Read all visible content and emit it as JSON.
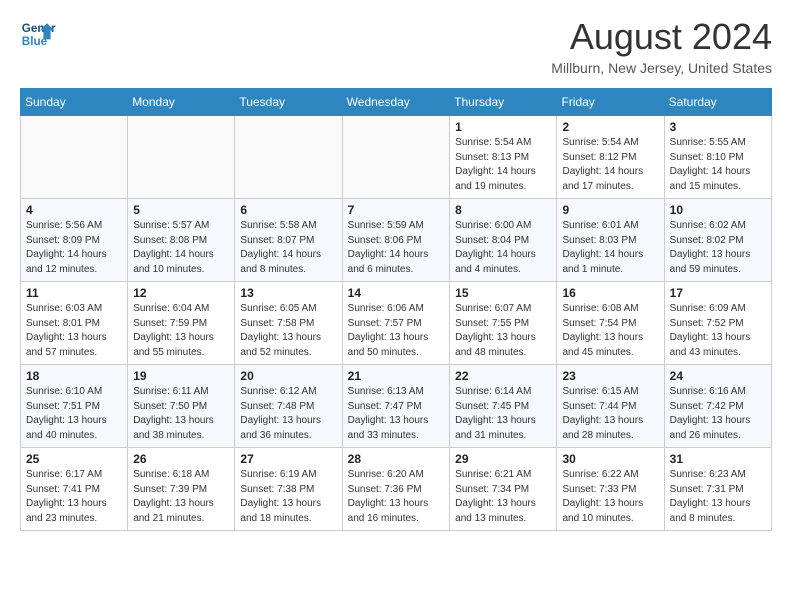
{
  "header": {
    "logo_line1": "General",
    "logo_line2": "Blue",
    "month_title": "August 2024",
    "location": "Millburn, New Jersey, United States"
  },
  "weekdays": [
    "Sunday",
    "Monday",
    "Tuesday",
    "Wednesday",
    "Thursday",
    "Friday",
    "Saturday"
  ],
  "weeks": [
    [
      {
        "day": "",
        "info": ""
      },
      {
        "day": "",
        "info": ""
      },
      {
        "day": "",
        "info": ""
      },
      {
        "day": "",
        "info": ""
      },
      {
        "day": "1",
        "info": "Sunrise: 5:54 AM\nSunset: 8:13 PM\nDaylight: 14 hours\nand 19 minutes."
      },
      {
        "day": "2",
        "info": "Sunrise: 5:54 AM\nSunset: 8:12 PM\nDaylight: 14 hours\nand 17 minutes."
      },
      {
        "day": "3",
        "info": "Sunrise: 5:55 AM\nSunset: 8:10 PM\nDaylight: 14 hours\nand 15 minutes."
      }
    ],
    [
      {
        "day": "4",
        "info": "Sunrise: 5:56 AM\nSunset: 8:09 PM\nDaylight: 14 hours\nand 12 minutes."
      },
      {
        "day": "5",
        "info": "Sunrise: 5:57 AM\nSunset: 8:08 PM\nDaylight: 14 hours\nand 10 minutes."
      },
      {
        "day": "6",
        "info": "Sunrise: 5:58 AM\nSunset: 8:07 PM\nDaylight: 14 hours\nand 8 minutes."
      },
      {
        "day": "7",
        "info": "Sunrise: 5:59 AM\nSunset: 8:06 PM\nDaylight: 14 hours\nand 6 minutes."
      },
      {
        "day": "8",
        "info": "Sunrise: 6:00 AM\nSunset: 8:04 PM\nDaylight: 14 hours\nand 4 minutes."
      },
      {
        "day": "9",
        "info": "Sunrise: 6:01 AM\nSunset: 8:03 PM\nDaylight: 14 hours\nand 1 minute."
      },
      {
        "day": "10",
        "info": "Sunrise: 6:02 AM\nSunset: 8:02 PM\nDaylight: 13 hours\nand 59 minutes."
      }
    ],
    [
      {
        "day": "11",
        "info": "Sunrise: 6:03 AM\nSunset: 8:01 PM\nDaylight: 13 hours\nand 57 minutes."
      },
      {
        "day": "12",
        "info": "Sunrise: 6:04 AM\nSunset: 7:59 PM\nDaylight: 13 hours\nand 55 minutes."
      },
      {
        "day": "13",
        "info": "Sunrise: 6:05 AM\nSunset: 7:58 PM\nDaylight: 13 hours\nand 52 minutes."
      },
      {
        "day": "14",
        "info": "Sunrise: 6:06 AM\nSunset: 7:57 PM\nDaylight: 13 hours\nand 50 minutes."
      },
      {
        "day": "15",
        "info": "Sunrise: 6:07 AM\nSunset: 7:55 PM\nDaylight: 13 hours\nand 48 minutes."
      },
      {
        "day": "16",
        "info": "Sunrise: 6:08 AM\nSunset: 7:54 PM\nDaylight: 13 hours\nand 45 minutes."
      },
      {
        "day": "17",
        "info": "Sunrise: 6:09 AM\nSunset: 7:52 PM\nDaylight: 13 hours\nand 43 minutes."
      }
    ],
    [
      {
        "day": "18",
        "info": "Sunrise: 6:10 AM\nSunset: 7:51 PM\nDaylight: 13 hours\nand 40 minutes."
      },
      {
        "day": "19",
        "info": "Sunrise: 6:11 AM\nSunset: 7:50 PM\nDaylight: 13 hours\nand 38 minutes."
      },
      {
        "day": "20",
        "info": "Sunrise: 6:12 AM\nSunset: 7:48 PM\nDaylight: 13 hours\nand 36 minutes."
      },
      {
        "day": "21",
        "info": "Sunrise: 6:13 AM\nSunset: 7:47 PM\nDaylight: 13 hours\nand 33 minutes."
      },
      {
        "day": "22",
        "info": "Sunrise: 6:14 AM\nSunset: 7:45 PM\nDaylight: 13 hours\nand 31 minutes."
      },
      {
        "day": "23",
        "info": "Sunrise: 6:15 AM\nSunset: 7:44 PM\nDaylight: 13 hours\nand 28 minutes."
      },
      {
        "day": "24",
        "info": "Sunrise: 6:16 AM\nSunset: 7:42 PM\nDaylight: 13 hours\nand 26 minutes."
      }
    ],
    [
      {
        "day": "25",
        "info": "Sunrise: 6:17 AM\nSunset: 7:41 PM\nDaylight: 13 hours\nand 23 minutes."
      },
      {
        "day": "26",
        "info": "Sunrise: 6:18 AM\nSunset: 7:39 PM\nDaylight: 13 hours\nand 21 minutes."
      },
      {
        "day": "27",
        "info": "Sunrise: 6:19 AM\nSunset: 7:38 PM\nDaylight: 13 hours\nand 18 minutes."
      },
      {
        "day": "28",
        "info": "Sunrise: 6:20 AM\nSunset: 7:36 PM\nDaylight: 13 hours\nand 16 minutes."
      },
      {
        "day": "29",
        "info": "Sunrise: 6:21 AM\nSunset: 7:34 PM\nDaylight: 13 hours\nand 13 minutes."
      },
      {
        "day": "30",
        "info": "Sunrise: 6:22 AM\nSunset: 7:33 PM\nDaylight: 13 hours\nand 10 minutes."
      },
      {
        "day": "31",
        "info": "Sunrise: 6:23 AM\nSunset: 7:31 PM\nDaylight: 13 hours\nand 8 minutes."
      }
    ]
  ]
}
